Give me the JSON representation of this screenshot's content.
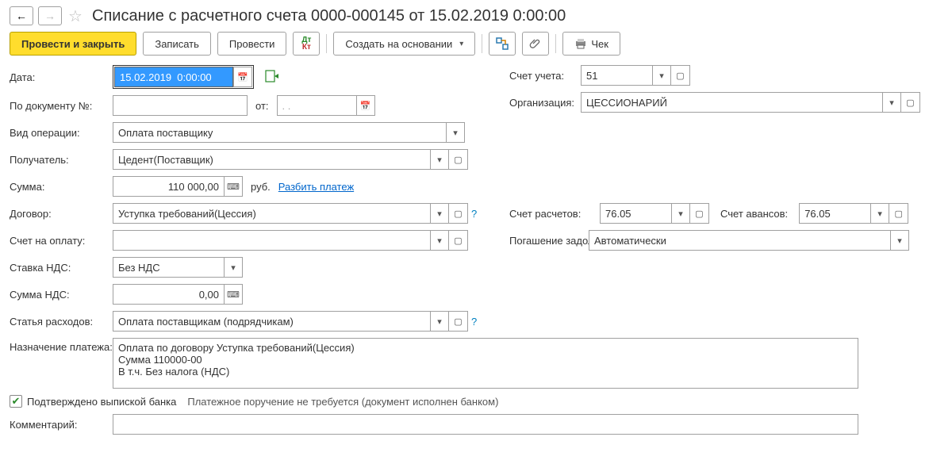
{
  "header": {
    "title": "Списание с расчетного счета 0000-000145 от 15.02.2019 0:00:00"
  },
  "toolbar": {
    "primary": "Провести и закрыть",
    "save": "Записать",
    "post": "Провести",
    "create_based": "Создать на основании",
    "cheque": "Чек"
  },
  "labels": {
    "date": "Дата:",
    "doc_no": "По документу №:",
    "from": "от:",
    "op_type": "Вид операции:",
    "recipient": "Получатель:",
    "amount": "Сумма:",
    "currency": "руб.",
    "split": "Разбить платеж",
    "contract": "Договор:",
    "invoice": "Счет на оплату:",
    "vat_rate": "Ставка НДС:",
    "vat_amount": "Сумма НДС:",
    "expense": "Статья расходов:",
    "purpose": "Назначение платежа:",
    "account": "Счет учета:",
    "org": "Организация:",
    "settle_acc": "Счет расчетов:",
    "advance_acc": "Счет авансов:",
    "debt": "Погашение задолженности:",
    "confirmed": "Подтверждено выпиской банка",
    "no_order": "Платежное поручение не требуется (документ исполнен банком)",
    "comment": "Комментарий:"
  },
  "values": {
    "date": "15.02.2019  0:00:00",
    "doc_no": "",
    "from_date": ". .",
    "op_type": "Оплата поставщику",
    "recipient": "Цедент(Поставщик)",
    "amount": "110 000,00",
    "contract": "Уступка требований(Цессия)",
    "invoice": "",
    "vat_rate": "Без НДС",
    "vat_amount": "0,00",
    "expense": "Оплата поставщикам (подрядчикам)",
    "purpose": "Оплата по договору Уступка требований(Цессия)\nСумма 110000-00\nВ т.ч. Без налога (НДС)",
    "account": "51",
    "org": "ЦЕССИОНАРИЙ",
    "settle_acc": "76.05",
    "advance_acc": "76.05",
    "debt": "Автоматически",
    "comment": ""
  }
}
